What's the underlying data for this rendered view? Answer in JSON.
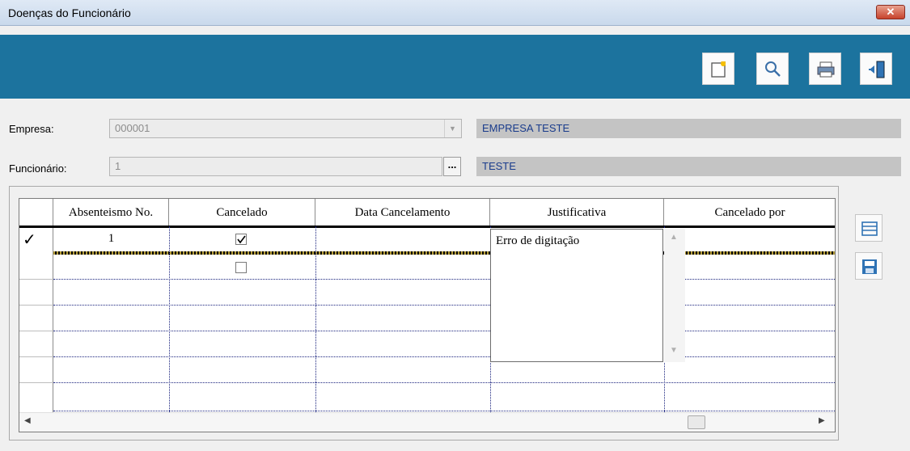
{
  "window": {
    "title": "Doenças do Funcionário",
    "close_label": "x"
  },
  "toolbar": {
    "buttons": [
      {
        "name": "new-icon"
      },
      {
        "name": "search-icon"
      },
      {
        "name": "print-icon"
      },
      {
        "name": "exit-icon"
      }
    ],
    "accent_color": "#1c739e"
  },
  "form": {
    "empresa_label": "Empresa:",
    "empresa_code": "000001",
    "empresa_name": "EMPRESA TESTE",
    "funcionario_label": "Funcionário:",
    "funcionario_code": "1",
    "funcionario_name": "TESTE",
    "ellipsis": "..."
  },
  "grid": {
    "columns": [
      "Absenteismo No.",
      "Cancelado",
      "Data Cancelamento",
      "Justificativa",
      "Cancelado por"
    ],
    "rows": [
      {
        "absenteismo": "1",
        "cancelado": true,
        "data_cancelamento": "",
        "justificativa": "Erro de digitação",
        "cancelado_por": ""
      },
      {
        "absenteismo": "",
        "cancelado": false,
        "data_cancelamento": "",
        "justificativa": "",
        "cancelado_por": ""
      }
    ],
    "row_indicator": "✓"
  }
}
